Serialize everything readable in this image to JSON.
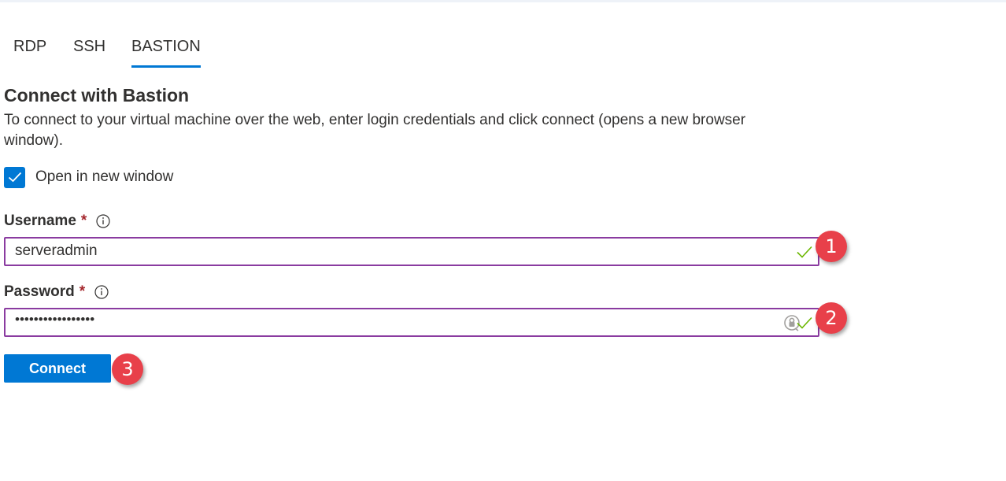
{
  "tabs": [
    {
      "label": "RDP",
      "active": false
    },
    {
      "label": "SSH",
      "active": false
    },
    {
      "label": "BASTION",
      "active": true
    }
  ],
  "section": {
    "heading": "Connect with Bastion",
    "description": "To connect to your virtual machine over the web, enter login credentials and click connect (opens a new browser window)."
  },
  "open_new_window": {
    "label": "Open in new window",
    "checked": true
  },
  "username": {
    "label": "Username",
    "required_mark": "*",
    "value": "serveradmin",
    "valid": true
  },
  "password": {
    "label": "Password",
    "required_mark": "*",
    "value_masked": "•••••••••••••••••",
    "valid": true
  },
  "connect_button": {
    "label": "Connect"
  },
  "annotations": [
    "1",
    "2",
    "3"
  ],
  "colors": {
    "accent": "#0078d4",
    "input_border": "#8a3ba0",
    "required": "#a4262c",
    "valid_check": "#6bb700",
    "badge": "#e8404a"
  },
  "icons": {
    "checkbox": "checkmark-icon",
    "info": "info-icon",
    "valid": "check-icon",
    "password_manager": "key-icon"
  }
}
